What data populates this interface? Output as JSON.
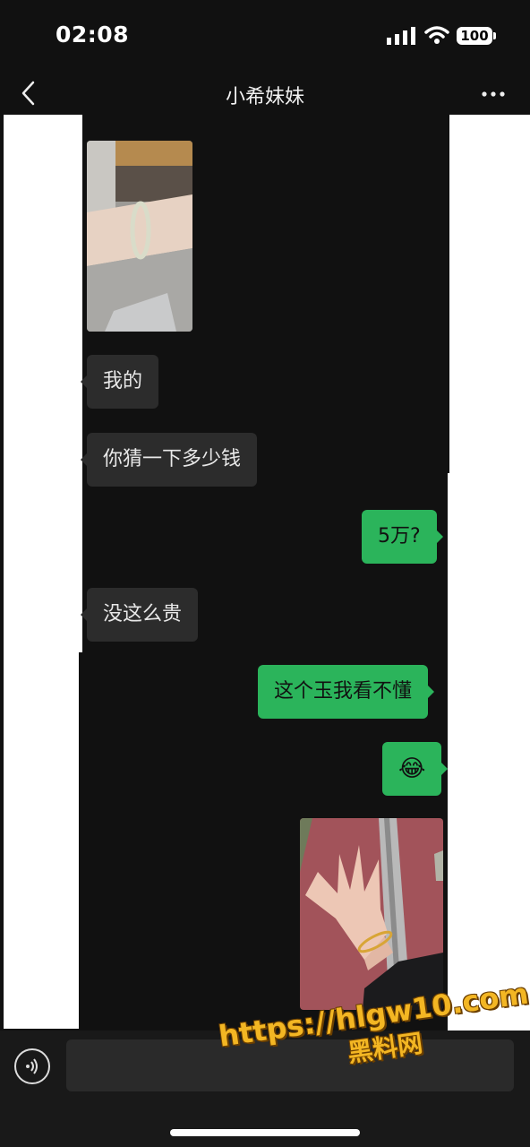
{
  "status_bar": {
    "time": "02:08",
    "battery": "100"
  },
  "header": {
    "title": "小希妹妹"
  },
  "messages": [
    {
      "type": "image",
      "side": "in",
      "description_icon": "photo-bracelet-wrist"
    },
    {
      "type": "text",
      "side": "in",
      "text": "我的"
    },
    {
      "type": "text",
      "side": "in",
      "text": "你猜一下多少钱"
    },
    {
      "type": "text",
      "side": "out",
      "text": "5万?"
    },
    {
      "type": "text",
      "side": "in",
      "text": "没这么贵"
    },
    {
      "type": "text",
      "side": "out",
      "text": "这个玉我看不懂"
    },
    {
      "type": "emoji",
      "side": "out",
      "text": "😂"
    },
    {
      "type": "image",
      "side": "out",
      "description_icon": "photo-hand-bracelet"
    }
  ],
  "watermark": {
    "url": "https://hlgw10.com",
    "name": "黑料网"
  },
  "colors": {
    "incoming_bubble": "#2c2c2c",
    "outgoing_bubble": "#2bb45b",
    "background": "#111111"
  }
}
